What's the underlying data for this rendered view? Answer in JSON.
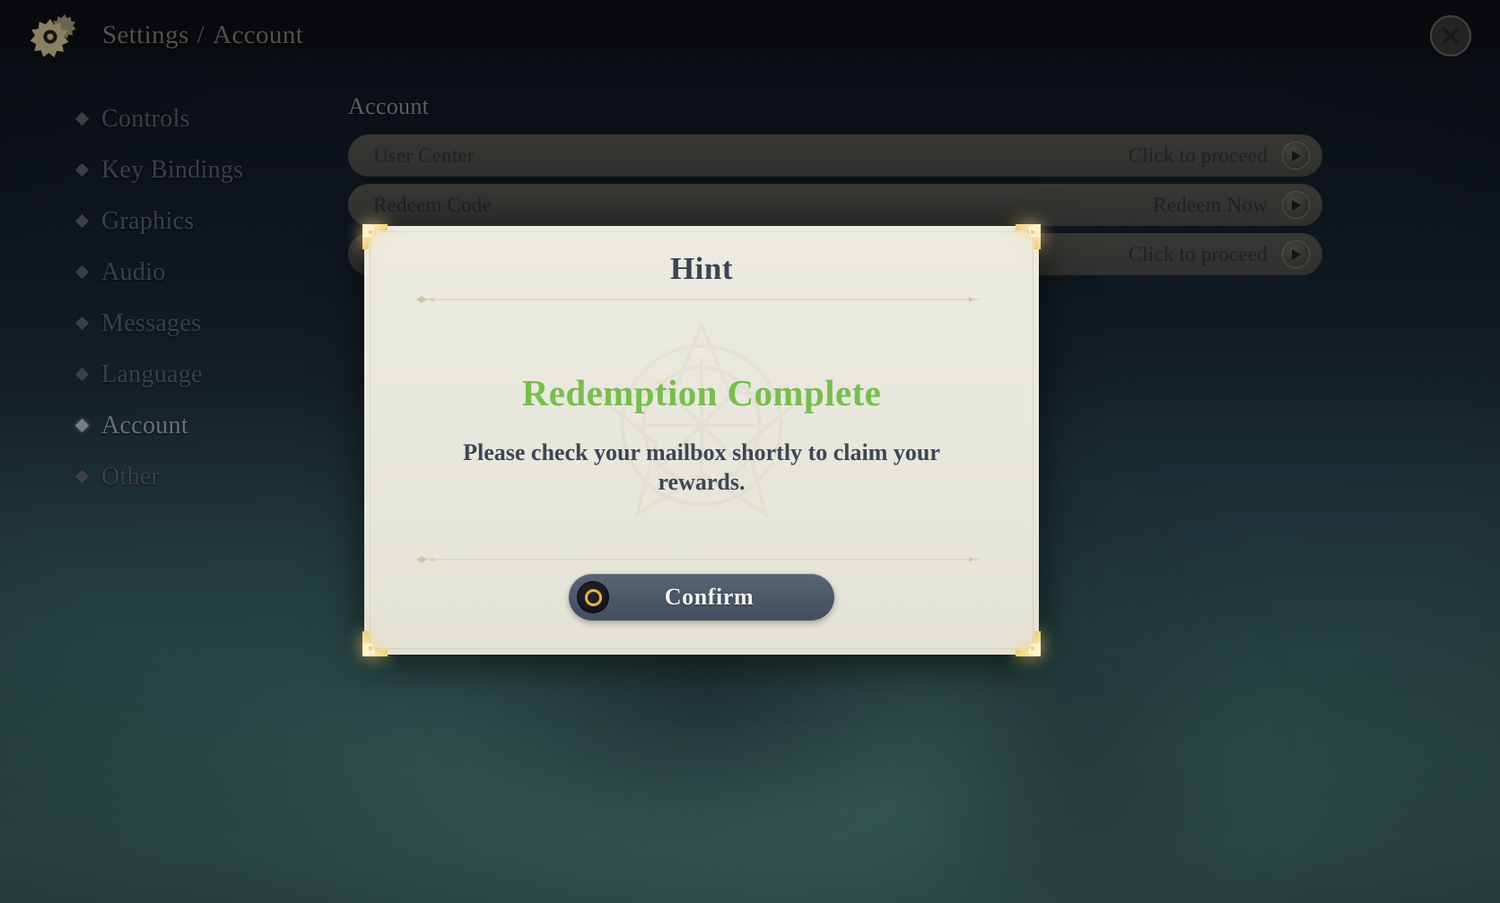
{
  "header": {
    "gear_icon": "gear-icon",
    "breadcrumb_root": "Settings",
    "breadcrumb_separator": "/",
    "breadcrumb_current": "Account",
    "close_icon": "close-icon"
  },
  "sidebar": {
    "items": [
      {
        "label": "Controls",
        "active": false
      },
      {
        "label": "Key Bindings",
        "active": false
      },
      {
        "label": "Graphics",
        "active": false
      },
      {
        "label": "Audio",
        "active": false
      },
      {
        "label": "Messages",
        "active": false
      },
      {
        "label": "Language",
        "active": false
      },
      {
        "label": "Account",
        "active": true
      },
      {
        "label": "Other",
        "active": false
      }
    ]
  },
  "settings_panel": {
    "title": "Account",
    "rows": [
      {
        "label": "User Center",
        "action": "Click to proceed",
        "arrow_icon": "arrow-right-icon"
      },
      {
        "label": "Redeem Code",
        "action": "Redeem Now",
        "arrow_icon": "arrow-right-icon"
      },
      {
        "label": "",
        "action": "Click to proceed",
        "arrow_icon": "arrow-right-icon"
      }
    ]
  },
  "modal": {
    "title": "Hint",
    "result_text": "Redemption Complete",
    "message": "Please check your mailbox shortly to claim your rewards.",
    "confirm_label": "Confirm",
    "confirm_key_icon": "key-ring-icon",
    "corner_icon": "gold-corner-ornament-icon",
    "divider_icon": "diamond-divider-icon"
  },
  "colors": {
    "accent_green": "#79bd4d",
    "gold": "#e8b53c",
    "modal_paper": "#e9e8de",
    "button_slate": "#4c576a",
    "title_navy": "#3a4453"
  }
}
